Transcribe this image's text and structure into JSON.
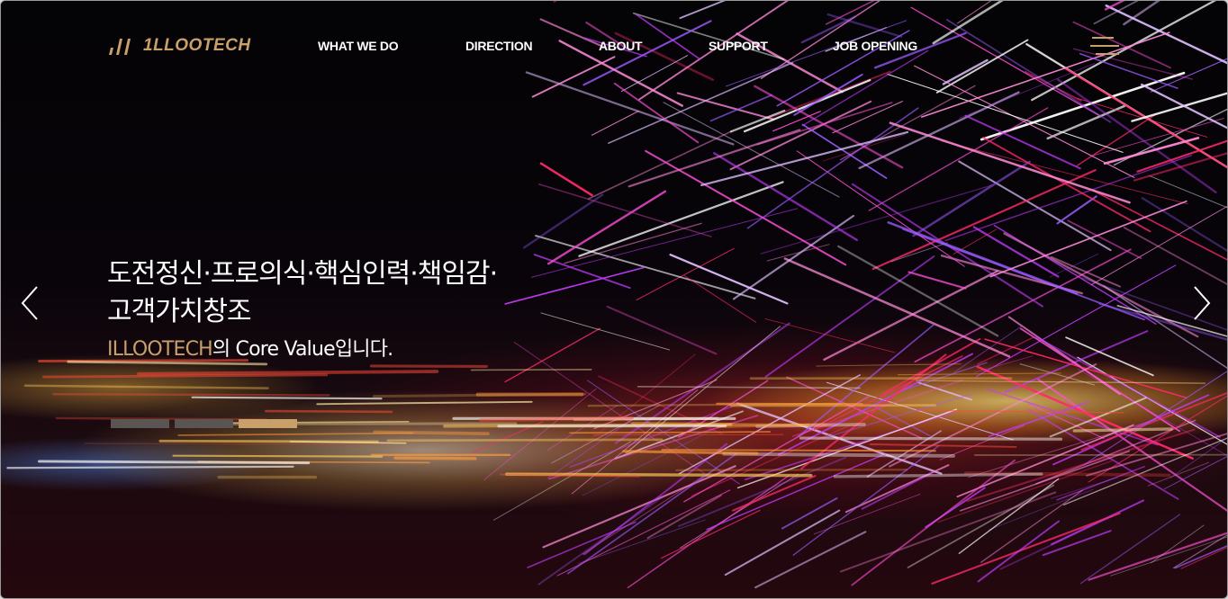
{
  "brand": {
    "logo_text": "1LLOOTECH",
    "accent_color": "#c9a06a"
  },
  "nav": {
    "items": [
      {
        "label": "WHAT WE DO"
      },
      {
        "label": "DIRECTION"
      },
      {
        "label": "ABOUT"
      },
      {
        "label": "SUPPORT"
      },
      {
        "label": "JOB OPENING"
      }
    ],
    "menu_icon": "hamburger-menu-icon"
  },
  "hero": {
    "headline_line1": "도전정신·프로의식·핵심인력·책임감·",
    "headline_line2": "고객가치창조",
    "sub_brand": "ILLOOTECH",
    "sub_rest": "의 Core Value입니다.",
    "prev_icon": "chevron-left-icon",
    "next_icon": "chevron-right-icon"
  },
  "slider": {
    "slide_count": 3,
    "active_index": 2
  }
}
